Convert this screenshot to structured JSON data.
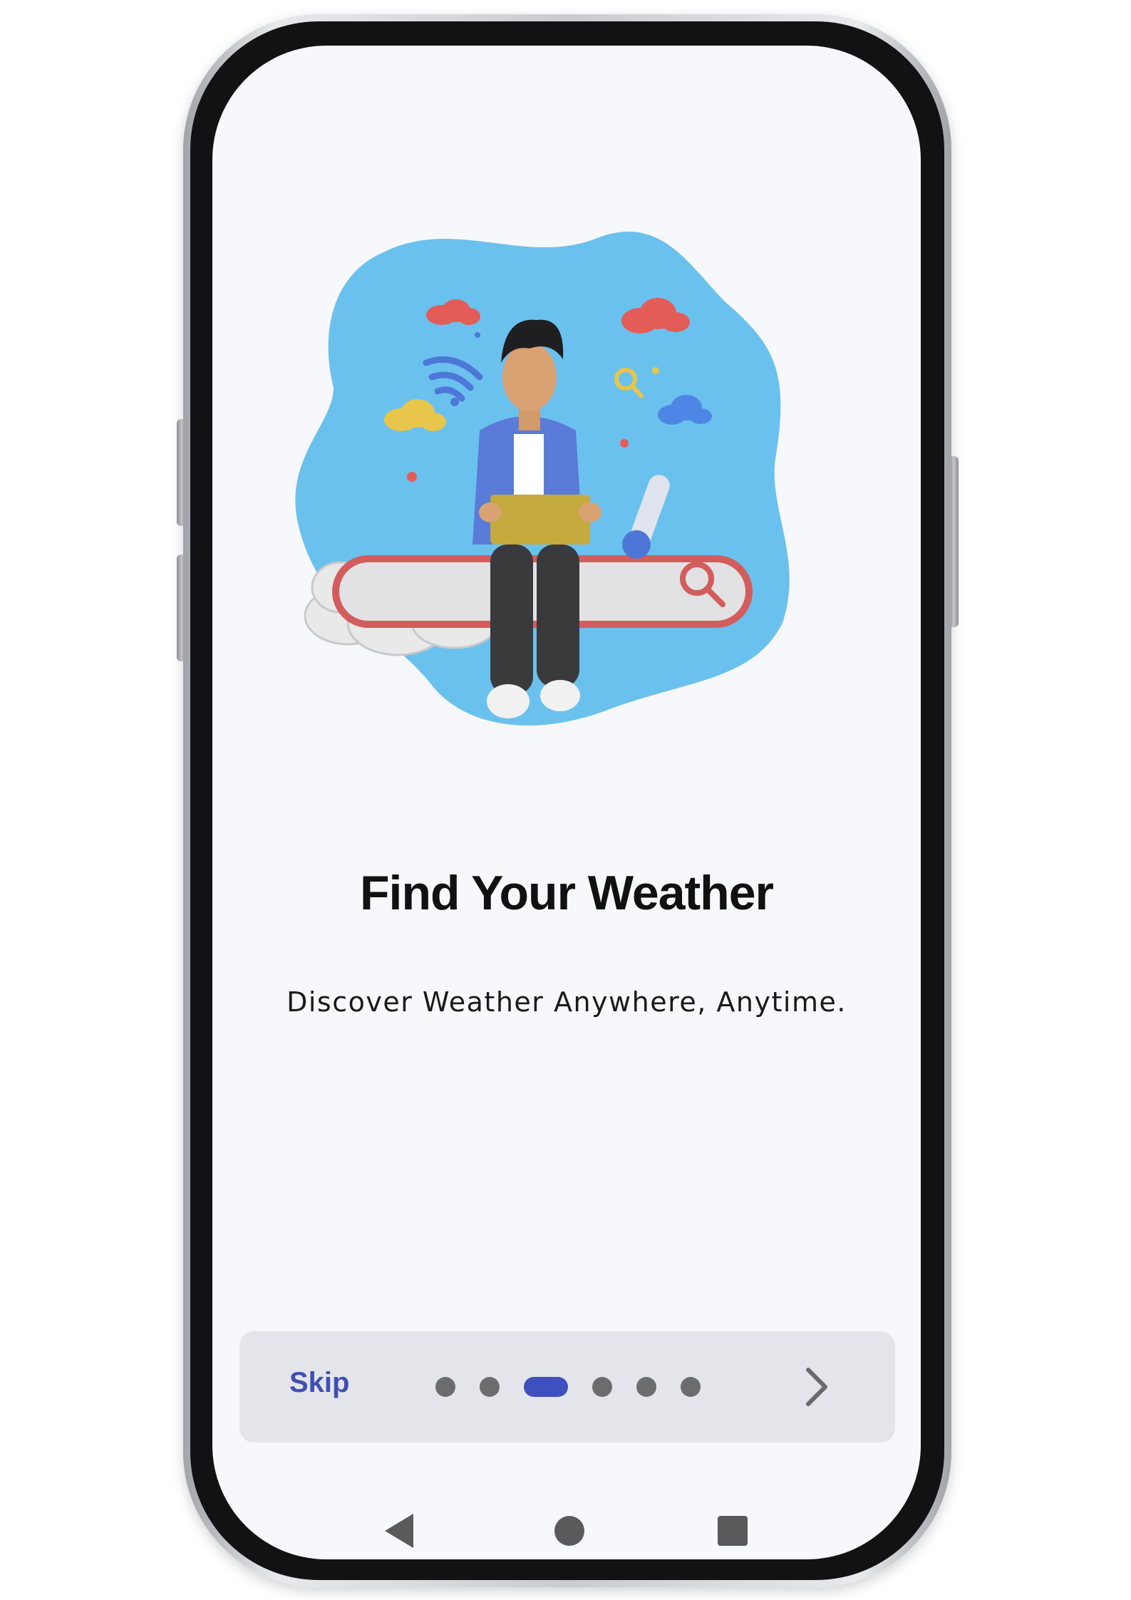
{
  "onboarding": {
    "title": "Find Your Weather",
    "subtitle": "Discover Weather Anywhere, Anytime.",
    "illustration": {
      "icon_name": "person-on-search-bar-illustration",
      "blob_color": "#6bc1ee"
    }
  },
  "bottom_bar": {
    "skip_label": "Skip",
    "page_count": 6,
    "active_page": 3,
    "active_dot_color": "#3e4fbe",
    "inactive_dot_color": "#6c6c6f",
    "next_icon": "chevron-right-icon"
  },
  "system_nav": {
    "back_icon": "back-triangle-icon",
    "home_icon": "home-circle-icon",
    "recents_icon": "recents-square-icon"
  },
  "colors": {
    "background": "#f7f8fc",
    "accent": "#3f4fb3",
    "card": "#e4e5ea"
  }
}
